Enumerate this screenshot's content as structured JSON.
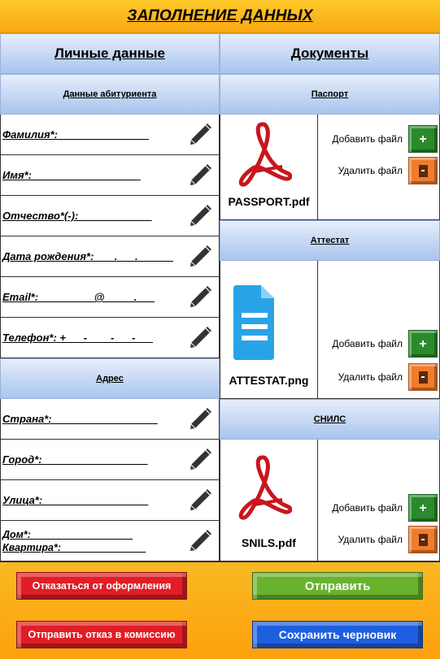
{
  "header": {
    "title": "ЗАПОЛНЕНИЕ ДАННЫХ"
  },
  "personal": {
    "title": "Личные данные",
    "applicant_section": "Данные абитуриента",
    "address_section": "Адрес",
    "applicant_fields": [
      "Фамилия*: _______________",
      "Имя*: __________________",
      "Отчество*(-): ____________",
      "Дата рождения*: ___.___.______",
      "Email*: _________@_____.___",
      "Телефон*: +___-____-___-___"
    ],
    "address_fields": [
      "Страна*:__________________",
      "Город*:__________________",
      "Улица*:__________________",
      "Дом*:__________________\nКвартира*:_______________"
    ]
  },
  "documents": {
    "title": "Документы",
    "items": [
      {
        "section": "Паспорт",
        "file_name": "PASSPORT.pdf",
        "icon": "pdf-icon"
      },
      {
        "section": "Аттестат",
        "file_name": "ATTESTAT.png",
        "icon": "document-icon"
      },
      {
        "section": "СНИЛС",
        "file_name": "SNILS.pdf",
        "icon": "pdf-icon"
      }
    ],
    "add_label": "Добавить файл",
    "delete_label": "Удалить файл"
  },
  "footer": {
    "cancel_label": "Отказаться от оформления",
    "send_label": "Отправить",
    "refuse_label": "Отправить отказ в комиссию",
    "draft_label": "Сохранить черновик"
  },
  "colors": {
    "header": "#fbb81e",
    "section": "#a9c4ee",
    "add_green": "#2b8a2b",
    "delete_orange": "#ef7d2d",
    "red_button": "#e11d26",
    "green_button": "#69b22e",
    "blue_button": "#1d5fe0"
  }
}
